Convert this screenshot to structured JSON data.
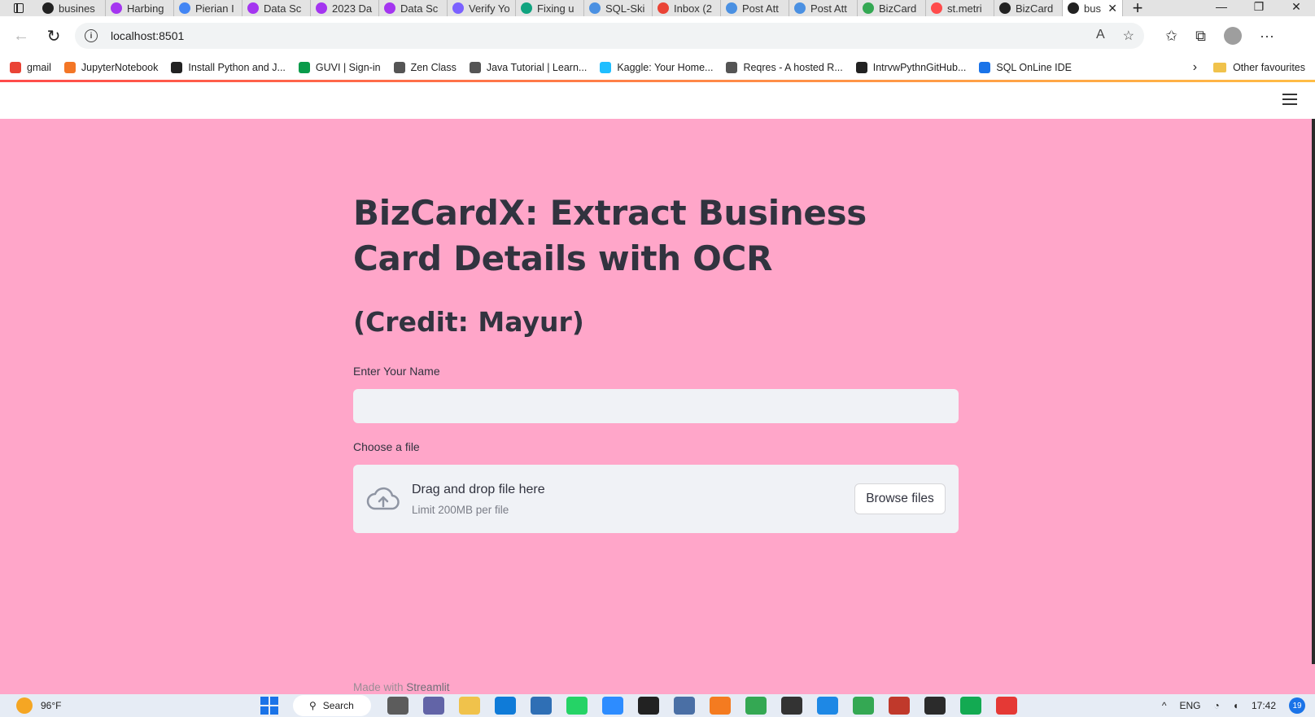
{
  "browser": {
    "tabs": [
      {
        "title": "busines",
        "icon": "streamlit-icon",
        "color": "#222222"
      },
      {
        "title": "Harbing",
        "icon": "udemy-icon",
        "color": "#a435f0"
      },
      {
        "title": "Pierian I",
        "icon": "doc-icon",
        "color": "#4285f4"
      },
      {
        "title": "Data Sc",
        "icon": "udemy-icon",
        "color": "#a435f0"
      },
      {
        "title": "2023 Da",
        "icon": "udemy-icon",
        "color": "#a435f0"
      },
      {
        "title": "Data Sc",
        "icon": "udemy-icon",
        "color": "#a435f0"
      },
      {
        "title": "Verify Yo",
        "icon": "verify-icon",
        "color": "#7b61ff"
      },
      {
        "title": "Fixing u",
        "icon": "chatgpt-icon",
        "color": "#10a37f"
      },
      {
        "title": "SQL-Ski",
        "icon": "zen-icon",
        "color": "#4a90e2"
      },
      {
        "title": "Inbox (2",
        "icon": "gmail-icon",
        "color": "#ea4335"
      },
      {
        "title": "Post Att",
        "icon": "zen-icon",
        "color": "#4a90e2"
      },
      {
        "title": "Post Att",
        "icon": "zen-icon",
        "color": "#4a90e2"
      },
      {
        "title": "BizCard",
        "icon": "drive-icon",
        "color": "#34a853"
      },
      {
        "title": "st.metri",
        "icon": "streamlit-crown-icon",
        "color": "#ff4b4b"
      },
      {
        "title": "BizCard",
        "icon": "github-icon",
        "color": "#222222"
      }
    ],
    "active_tab": {
      "title": "bus",
      "icon": "streamlit-icon",
      "close": "✕"
    },
    "new_tab": "+",
    "window_controls": {
      "minimize": "—",
      "restore": "❐",
      "close": "✕"
    },
    "url": "localhost:8501",
    "bookmarks": [
      {
        "label": "gmail",
        "icon": "gmail-icon",
        "color": "#ea4335"
      },
      {
        "label": "JupyterNotebook",
        "icon": "jupyter-icon",
        "color": "#f37626"
      },
      {
        "label": "Install Python and J...",
        "icon": "video-icon",
        "color": "#222222"
      },
      {
        "label": "GUVI | Sign-in",
        "icon": "guvi-icon",
        "color": "#0a9b4a"
      },
      {
        "label": "Zen Class",
        "icon": "zen-icon",
        "color": "#555555"
      },
      {
        "label": "Java Tutorial | Learn...",
        "icon": "page-icon",
        "color": "#555555"
      },
      {
        "label": "Kaggle: Your Home...",
        "icon": "kaggle-icon",
        "color": "#20beff"
      },
      {
        "label": "Reqres - A hosted R...",
        "icon": "page-icon",
        "color": "#555555"
      },
      {
        "label": "IntrvwPythnGitHub...",
        "icon": "github-icon",
        "color": "#222222"
      },
      {
        "label": "SQL OnLine IDE",
        "icon": "sql-icon",
        "color": "#1a73e8"
      }
    ],
    "other_favourites": "Other favourites"
  },
  "app": {
    "background_color": "#ffa6c9",
    "title": "BizCardX: Extract Business Card Details with OCR",
    "subtitle": "(Credit: Mayur)",
    "name_label": "Enter Your Name",
    "name_value": "",
    "file_label": "Choose a file",
    "uploader": {
      "drag_text": "Drag and drop file here",
      "limit_text": "Limit 200MB per file",
      "button_label": "Browse files"
    },
    "footer_prefix": "Made with",
    "footer_brand": "Streamlit"
  },
  "taskbar": {
    "weather_temp": "96°F",
    "search_label": "Search",
    "language": "ENG",
    "time": "17:42",
    "notification_count": "19"
  }
}
